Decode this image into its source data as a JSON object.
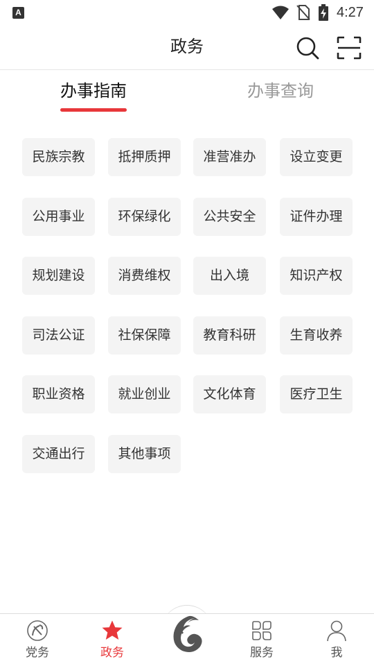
{
  "status_bar": {
    "time": "4:27",
    "left_icon_letter": "A"
  },
  "header": {
    "title": "政务"
  },
  "tabs": [
    {
      "label": "办事指南",
      "active": true
    },
    {
      "label": "办事查询",
      "active": false
    }
  ],
  "categories": [
    "民族宗教",
    "抵押质押",
    "准营准办",
    "设立变更",
    "公用事业",
    "环保绿化",
    "公共安全",
    "证件办理",
    "规划建设",
    "消费维权",
    "出入境",
    "知识产权",
    "司法公证",
    "社保保障",
    "教育科研",
    "生育收养",
    "职业资格",
    "就业创业",
    "文化体育",
    "医疗卫生",
    "交通出行",
    "其他事项"
  ],
  "bottom_nav": [
    {
      "label": "党务",
      "icon": "party-emblem-icon",
      "active": false
    },
    {
      "label": "政务",
      "icon": "star-icon",
      "active": true
    },
    {
      "label": "",
      "icon": "app-logo-icon",
      "active": false
    },
    {
      "label": "服务",
      "icon": "services-grid-icon",
      "active": false
    },
    {
      "label": "我",
      "icon": "person-icon",
      "active": false
    }
  ],
  "colors": {
    "accent": "#e8373a",
    "tile_bg": "#f4f4f4",
    "inactive_text": "#999999"
  }
}
